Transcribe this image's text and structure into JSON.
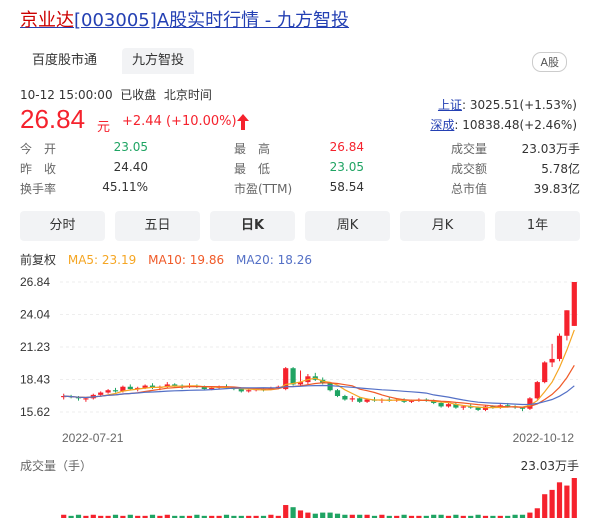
{
  "title": {
    "name": "京业达",
    "code_text": "[003005]",
    "rest": "A股实时行情 - 九方智投"
  },
  "tabs": {
    "tab1": "百度股市通",
    "tab2": "九方智投",
    "badge": "A股"
  },
  "quote": {
    "datetime": "10-12 15:00:00",
    "status": "已收盘",
    "timezone": "北京时间",
    "price": "26.84",
    "unit": "元",
    "change": "+2.44",
    "change_pct": "(+10.00%)"
  },
  "indices": [
    {
      "name": "上证",
      "value": "3025.51(+1.53%)"
    },
    {
      "name": "深成",
      "value": "10838.48(+2.46%)"
    }
  ],
  "stats": [
    [
      {
        "label": "今　开",
        "value": "23.05",
        "color": "green"
      },
      {
        "label": "最　高",
        "value": "26.84",
        "color": "red"
      },
      {
        "label": "成交量",
        "value": "23.03万手",
        "color": "black"
      }
    ],
    [
      {
        "label": "昨　收",
        "value": "24.40",
        "color": "black"
      },
      {
        "label": "最　低",
        "value": "23.05",
        "color": "green"
      },
      {
        "label": "成交额",
        "value": "5.78亿",
        "color": "black"
      }
    ],
    [
      {
        "label": "换手率",
        "value": "45.11%",
        "color": "black"
      },
      {
        "label": "市盈(TTM)",
        "value": "58.54",
        "color": "black"
      },
      {
        "label": "总市值",
        "value": "39.83亿",
        "color": "black"
      }
    ]
  ],
  "periods": [
    "分时",
    "五日",
    "日K",
    "周K",
    "月K",
    "1年"
  ],
  "active_period": "日K",
  "legend": {
    "adjust": "前复权",
    "ma5": "MA5: 23.19",
    "ma10": "MA10: 19.86",
    "ma20": "MA20: 18.26"
  },
  "colors": {
    "up": "#f5222d",
    "down": "#1fa463",
    "ma5": "#f5a623",
    "ma10": "#f05a28",
    "ma20": "#5470c6",
    "link": "#2440b3"
  },
  "chart_data": {
    "type": "candlestick",
    "y_ticks": [
      "26.84",
      "24.04",
      "21.23",
      "18.43",
      "15.62"
    ],
    "ylim": [
      15.62,
      26.84
    ],
    "x_labels": [
      "2022-07-21",
      "2022-10-12"
    ],
    "volume_label": "成交量（手）",
    "volume_max": "23.03万手",
    "candles": [
      [
        16.9,
        17.2,
        16.7,
        17.0
      ],
      [
        17.0,
        17.1,
        16.8,
        16.9
      ],
      [
        16.9,
        17.0,
        16.6,
        16.8
      ],
      [
        16.7,
        16.9,
        16.5,
        16.8
      ],
      [
        16.8,
        17.2,
        16.7,
        17.1
      ],
      [
        17.1,
        17.4,
        17.0,
        17.3
      ],
      [
        17.3,
        17.6,
        17.2,
        17.5
      ],
      [
        17.5,
        17.7,
        17.3,
        17.4
      ],
      [
        17.4,
        17.9,
        17.3,
        17.8
      ],
      [
        17.8,
        18.0,
        17.5,
        17.6
      ],
      [
        17.6,
        17.8,
        17.4,
        17.7
      ],
      [
        17.7,
        18.0,
        17.6,
        17.9
      ],
      [
        17.9,
        18.1,
        17.6,
        17.7
      ],
      [
        17.7,
        17.9,
        17.5,
        17.8
      ],
      [
        17.8,
        18.2,
        17.7,
        18.0
      ],
      [
        18.0,
        18.1,
        17.8,
        17.9
      ],
      [
        17.9,
        18.0,
        17.6,
        17.8
      ],
      [
        17.8,
        18.1,
        17.7,
        17.9
      ],
      [
        17.9,
        18.0,
        17.7,
        17.8
      ],
      [
        17.8,
        17.9,
        17.5,
        17.6
      ],
      [
        17.6,
        17.8,
        17.5,
        17.7
      ],
      [
        17.7,
        17.9,
        17.6,
        17.8
      ],
      [
        17.8,
        18.0,
        17.6,
        17.7
      ],
      [
        17.7,
        17.8,
        17.5,
        17.6
      ],
      [
        17.6,
        17.7,
        17.3,
        17.4
      ],
      [
        17.4,
        17.6,
        17.3,
        17.5
      ],
      [
        17.5,
        17.6,
        17.4,
        17.6
      ],
      [
        17.6,
        17.7,
        17.4,
        17.5
      ],
      [
        17.6,
        17.8,
        17.5,
        17.7
      ],
      [
        17.7,
        17.9,
        17.6,
        17.8
      ],
      [
        17.6,
        19.5,
        17.5,
        19.4
      ],
      [
        19.4,
        19.5,
        17.9,
        18.0
      ],
      [
        18.0,
        19.2,
        17.9,
        18.2
      ],
      [
        18.2,
        18.9,
        18.0,
        18.7
      ],
      [
        18.7,
        19.0,
        18.3,
        18.4
      ],
      [
        18.4,
        18.6,
        18.0,
        18.1
      ],
      [
        18.1,
        18.2,
        17.4,
        17.5
      ],
      [
        17.5,
        17.6,
        16.9,
        17.0
      ],
      [
        17.0,
        17.1,
        16.6,
        16.7
      ],
      [
        16.7,
        17.0,
        16.5,
        16.8
      ],
      [
        16.8,
        16.9,
        16.4,
        16.5
      ],
      [
        16.5,
        16.8,
        16.4,
        16.7
      ],
      [
        16.7,
        16.9,
        16.5,
        16.6
      ],
      [
        16.6,
        16.8,
        16.4,
        16.7
      ],
      [
        16.7,
        16.9,
        16.5,
        16.6
      ],
      [
        16.6,
        16.8,
        16.5,
        16.7
      ],
      [
        16.7,
        16.8,
        16.4,
        16.5
      ],
      [
        16.5,
        16.7,
        16.4,
        16.6
      ],
      [
        16.6,
        16.8,
        16.5,
        16.7
      ],
      [
        16.7,
        16.8,
        16.5,
        16.6
      ],
      [
        16.6,
        16.7,
        16.3,
        16.4
      ],
      [
        16.4,
        16.5,
        16.0,
        16.1
      ],
      [
        16.1,
        16.4,
        16.0,
        16.3
      ],
      [
        16.3,
        16.4,
        15.9,
        16.0
      ],
      [
        16.0,
        16.2,
        15.8,
        16.1
      ],
      [
        16.1,
        16.3,
        15.9,
        16.0
      ],
      [
        16.0,
        16.1,
        15.7,
        15.8
      ],
      [
        15.8,
        16.2,
        15.7,
        16.1
      ],
      [
        16.1,
        16.2,
        15.9,
        16.0
      ],
      [
        16.0,
        16.3,
        15.9,
        16.2
      ],
      [
        16.2,
        16.4,
        16.0,
        16.1
      ],
      [
        16.1,
        16.2,
        15.9,
        16.0
      ],
      [
        16.0,
        16.1,
        15.7,
        15.9
      ],
      [
        15.9,
        16.9,
        15.8,
        16.8
      ],
      [
        16.8,
        18.3,
        16.7,
        18.2
      ],
      [
        18.2,
        20.0,
        18.1,
        19.9
      ],
      [
        19.9,
        21.5,
        19.5,
        20.2
      ],
      [
        20.2,
        22.4,
        20.0,
        22.2
      ],
      [
        22.2,
        24.4,
        21.8,
        24.4
      ],
      [
        23.05,
        26.84,
        23.05,
        26.84
      ]
    ],
    "volumes": [
      0.03,
      0.02,
      0.03,
      0.02,
      0.03,
      0.02,
      0.02,
      0.03,
      0.02,
      0.03,
      0.02,
      0.02,
      0.03,
      0.02,
      0.03,
      0.02,
      0.02,
      0.02,
      0.03,
      0.02,
      0.02,
      0.02,
      0.03,
      0.02,
      0.02,
      0.02,
      0.02,
      0.02,
      0.03,
      0.02,
      0.12,
      0.1,
      0.07,
      0.05,
      0.04,
      0.05,
      0.05,
      0.04,
      0.03,
      0.03,
      0.03,
      0.03,
      0.02,
      0.03,
      0.02,
      0.02,
      0.03,
      0.02,
      0.02,
      0.02,
      0.03,
      0.03,
      0.02,
      0.03,
      0.02,
      0.02,
      0.03,
      0.02,
      0.02,
      0.02,
      0.02,
      0.03,
      0.03,
      0.05,
      0.09,
      0.22,
      0.26,
      0.33,
      0.3,
      0.37
    ]
  }
}
